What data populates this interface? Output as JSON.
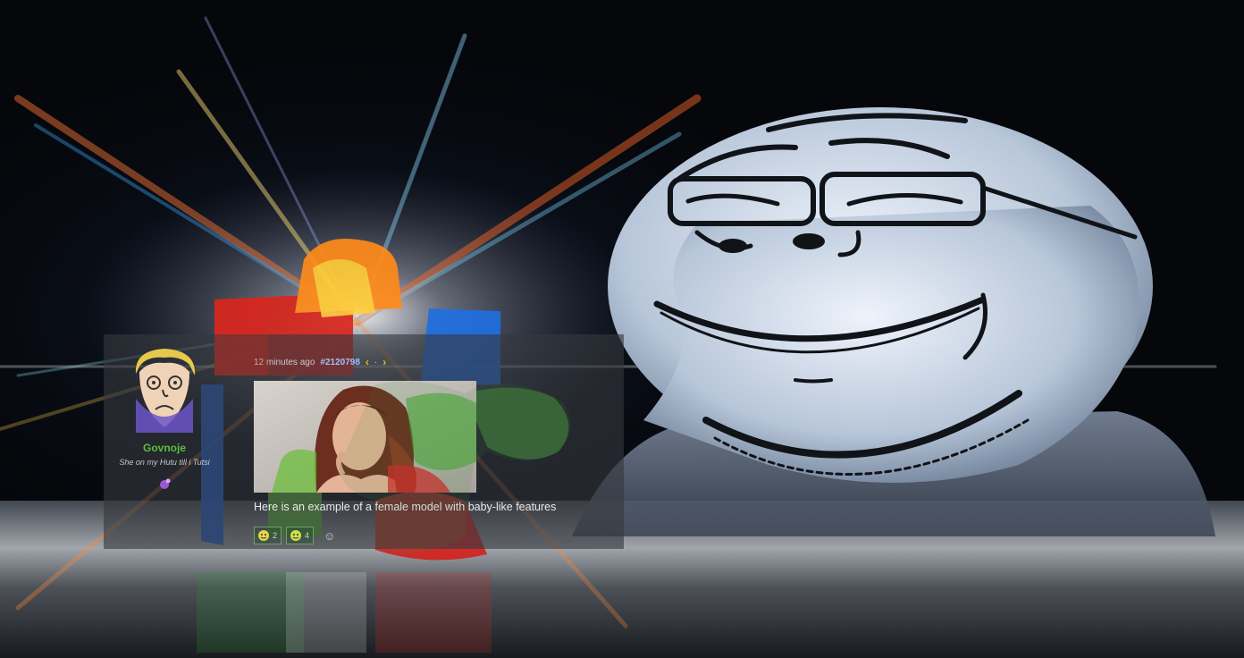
{
  "post": {
    "username": "Govnoje",
    "user_title": "She on my Hutu till i Tutsi",
    "timestamp": "12 minutes ago",
    "post_id": "#2120798",
    "nav_prev": "‹",
    "nav_dot": "·",
    "nav_next": "›",
    "message": "Here is an example of a female model with baby-like features",
    "reactions": [
      {
        "icon": "smiley-face-icon",
        "count": "2"
      },
      {
        "icon": "smiley-face-icon",
        "count": "4"
      }
    ],
    "add_reaction": "☺"
  },
  "colors": {
    "username": "#5bbf3b",
    "post_id": "#9fc0ff",
    "nav": "#f0b820",
    "panel": "rgba(54,56,62,0.62)"
  }
}
